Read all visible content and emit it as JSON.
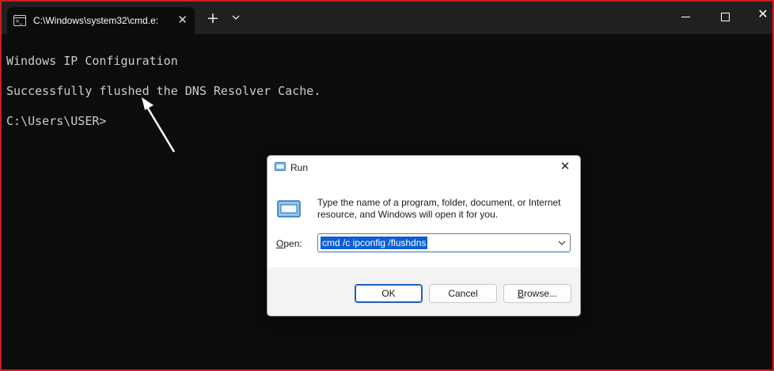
{
  "window": {
    "tab_title": "C:\\Windows\\system32\\cmd.e:",
    "tab_close": "✕",
    "new_tab": "+",
    "close": "✕"
  },
  "console": {
    "lines": [
      "Windows IP Configuration",
      "Successfully flushed the DNS Resolver Cache.",
      "C:\\Users\\USER>"
    ]
  },
  "run_dialog": {
    "title": "Run",
    "close": "✕",
    "description": "Type the name of a program, folder, document, or Internet resource, and Windows will open it for you.",
    "open_label_first": "O",
    "open_label_rest": "pen:",
    "open_value": "cmd /c ipconfig /flushdns",
    "ok_label": "OK",
    "cancel_label": "Cancel",
    "browse_label_first": "B",
    "browse_label_rest": "rowse..."
  },
  "colors": {
    "terminal_bg": "#0c0c0c",
    "titlebar_bg": "#202020",
    "accent": "#0b5fd1",
    "frame_border": "#d01c1c"
  },
  "icons": [
    "console-icon",
    "chevron-down-icon",
    "minimize-icon",
    "maximize-icon",
    "close-icon",
    "run-icon",
    "pointer-arrow"
  ]
}
